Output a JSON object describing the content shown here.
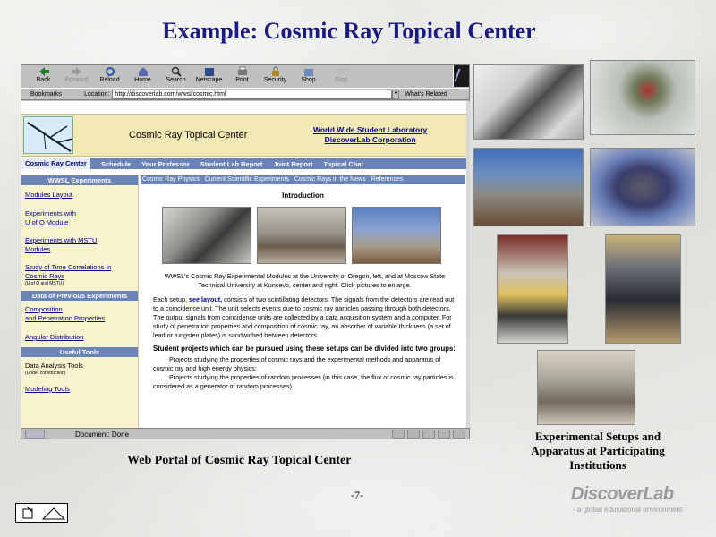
{
  "slide": {
    "title": "Example: Cosmic Ray Topical Center",
    "caption_left": "Web Portal of Cosmic Ray Topical Center",
    "caption_right": "Experimental Setups and Apparatus at Participating Institutions",
    "page_number": "-7-",
    "brand": "DiscoverLab",
    "brand_tagline": "- a global educational environment"
  },
  "browser": {
    "toolbar": [
      {
        "label": "Back",
        "icon": "back-arrow-icon",
        "enabled": true
      },
      {
        "label": "Forward",
        "icon": "forward-arrow-icon",
        "enabled": false
      },
      {
        "label": "Reload",
        "icon": "reload-icon",
        "enabled": true
      },
      {
        "label": "Home",
        "icon": "home-icon",
        "enabled": true
      },
      {
        "label": "Search",
        "icon": "search-icon",
        "enabled": true
      },
      {
        "label": "Netscape",
        "icon": "netscape-icon",
        "enabled": true
      },
      {
        "label": "Print",
        "icon": "print-icon",
        "enabled": true
      },
      {
        "label": "Security",
        "icon": "lock-icon",
        "enabled": true
      },
      {
        "label": "Shop",
        "icon": "shop-icon",
        "enabled": true
      },
      {
        "label": "Stop",
        "icon": "stop-icon",
        "enabled": false
      }
    ],
    "bookmarks_label": "Bookmarks",
    "location_label": "Location:",
    "url": "http://discoverlab.com/wwsl/cosmic.html",
    "related_label": "What's Related",
    "status": "Document: Done"
  },
  "site": {
    "banner_title": "Cosmic Ray Topical Center",
    "banner_link1": "World Wide Student Laboratory",
    "banner_link2": "DiscoverLab Corporation",
    "nav": [
      "Cosmic Ray Center",
      "Schedule",
      "Your Professor",
      "Student Lab Report",
      "Joint Report",
      "Topical Chat"
    ],
    "sidebar": {
      "sec1": "WWSL Experiments",
      "link1": "Modules Layout",
      "link2a": "Experiments with",
      "link2b": "U of O Module",
      "link3a": "Experiments with MSTU",
      "link3b": "Modules",
      "link4a": "Study of Time Correlations in",
      "link4b": "Cosmic Rays",
      "link4_note": "(U of O and MSTU)",
      "sec2": "Data of Previous Experiments",
      "link5a": "Composition",
      "link5b": "and Penetration Properties",
      "link6": "Angular Distribution",
      "sec3": "Useful Tools",
      "tool1": "Data Analysis Tools",
      "tool1_note": "(Under construction)",
      "tool2": "Modeling Tools"
    },
    "content_tabs": [
      "Cosmic Ray Physics",
      "Current Scientific Experiments",
      "Cosmic Rays in the News",
      "References"
    ],
    "intro_heading": "Introduction",
    "para1": "WWSL's Cosmic Ray Experimental Modules at the University of Oregon, left, and at Moscow State Technical University at Kuncevo, center and right. Click pictures to enlarge.",
    "para2_pre": "Each setup,",
    "para2_link": "see layout,",
    "para2_post": "consists of two scintillating detectors. The signals from the detectors are read out to a coincidence unit. The unit selects events due to cosmic ray particles passing through both detectors. The output signals from coincidence units are collected by a data acquisition system and a computer. For study of penetration properties and composition of cosmic ray, an absorber of variable thickness (a set of lead or tungsten plates) is sandwiched between detectors.",
    "para3": "Student projects which can be pursued using these setups can be divided into two groups:",
    "para4": "Projects studying the properties of cosmic rays and the experimental methods and apparatus of cosmic ray and high energy physics;",
    "para5": "Projects studying the properties of random processes (in this case, the flux of cosmic ray particles is considered as a generator of random processes)."
  }
}
